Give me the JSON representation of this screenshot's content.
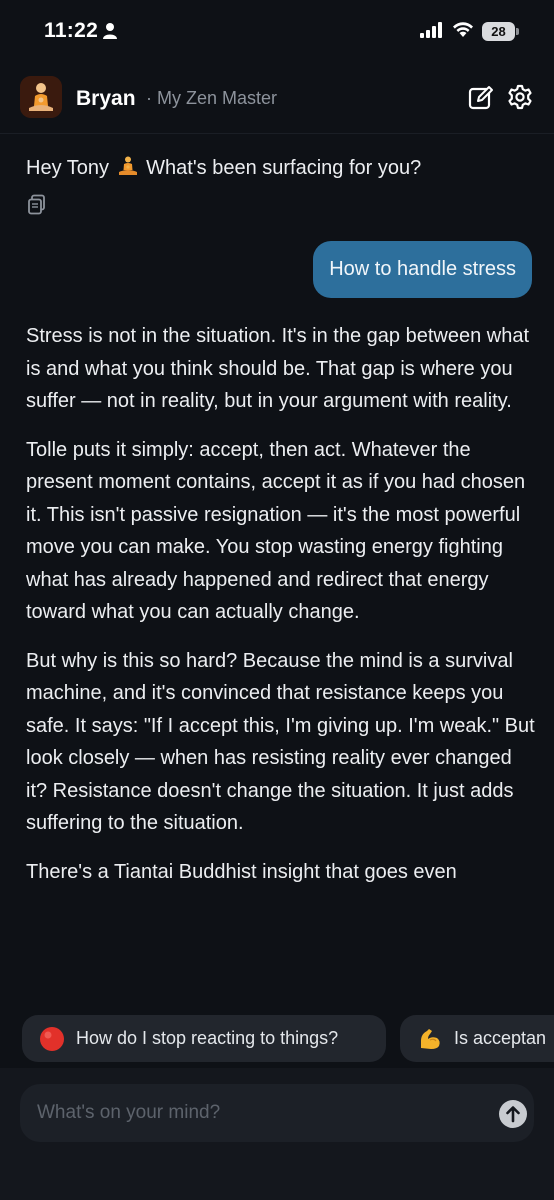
{
  "status_bar": {
    "time": "11:22",
    "battery": "28",
    "icons": [
      "person-icon",
      "signal-icon",
      "wifi-icon",
      "battery-icon"
    ]
  },
  "header": {
    "bot_name": "Bryan",
    "bot_subtitle": "· My Zen Master",
    "icons": [
      "meditation-avatar-icon",
      "edit-icon",
      "gear-icon"
    ]
  },
  "conversation": {
    "greeting_before": "Hey Tony",
    "greeting_after": "What's been surfacing for you?",
    "greeting_emoji": "person-in-lotus-position-icon",
    "user_message": "How to handle stress",
    "response_paragraphs": [
      "Stress is not in the situation. It's in the gap between what is and what you think should be. That gap is where you suffer — not in reality, but in your argument with reality.",
      "Tolle puts it simply: accept, then act. Whatever the present moment contains, accept it as if you had chosen it. This isn't passive resignation — it's the most powerful move you can make. You stop wasting energy fighting what has already happened and redirect that energy toward what you can actually change.",
      "But why is this so hard? Because the mind is a survival machine, and it's convinced that resistance keeps you safe. It says: \"If I accept this, I'm giving up. I'm weak.\" But look closely — when has resisting reality ever changed it? Resistance doesn't change the situation. It just adds suffering to the situation.",
      "There's a Tiantai Buddhist insight that goes even"
    ]
  },
  "suggestions": [
    {
      "label": "How do I stop reacting to things?",
      "icon": "red-circle-icon"
    },
    {
      "label": "Is acceptan",
      "icon": "flexed-biceps-icon"
    }
  ],
  "composer": {
    "placeholder": "What's on your mind?",
    "value": ""
  },
  "colors": {
    "background": "#0e1116",
    "user_bubble": "#2d6f9c",
    "chip": "#22262d",
    "composer": "#1c2027"
  }
}
